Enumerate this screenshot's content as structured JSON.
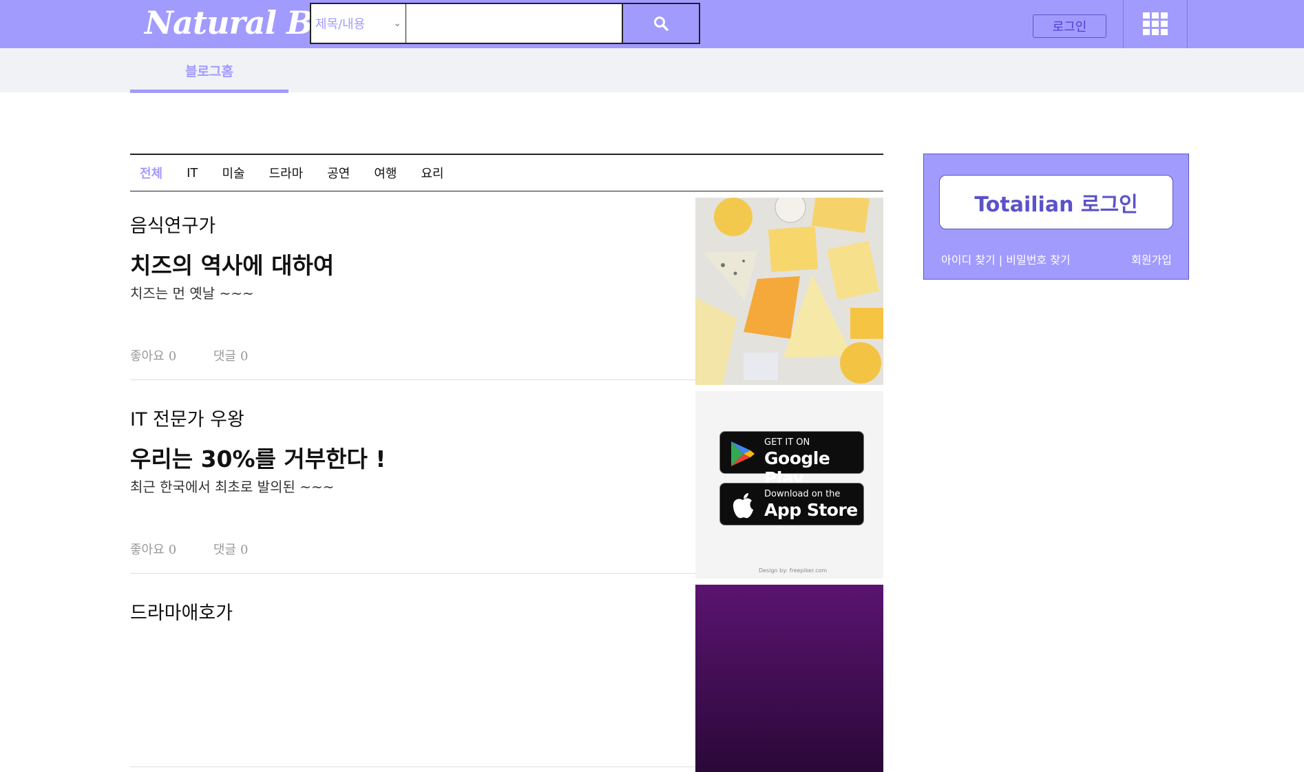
{
  "header": {
    "logo": "Natural Blog",
    "search_select": "제목/내용",
    "search_value": "",
    "login_label": "로그인"
  },
  "subnav": {
    "tab_label": "블로그홈"
  },
  "categories": [
    "전체",
    "IT",
    "미술",
    "드라마",
    "공연",
    "여행",
    "요리"
  ],
  "posts": [
    {
      "author": "음식연구가",
      "title": "치즈의 역사에 대하여",
      "excerpt": "치즈는 먼 옛날 ~~~",
      "likes_label": "좋아요",
      "likes": "0",
      "comments_label": "댓글",
      "comments": "0"
    },
    {
      "author": "IT 전문가 우왕",
      "title": "우리는 30%를 거부한다 !",
      "excerpt": "최근 한국에서 최초로 발의된 ~~~",
      "likes_label": "좋아요",
      "likes": "0",
      "comments_label": "댓글",
      "comments": "0",
      "badges": {
        "google_small": "GET IT ON",
        "google_big": "Google Play",
        "apple_small": "Download on the",
        "apple_big": "App Store",
        "credit": "Design by: freepiker.com"
      }
    },
    {
      "author": "드라마애호가"
    }
  ],
  "sidebar": {
    "login_button": "Totailian 로그인",
    "find_links": "아이디 찾기 | 비밀번호 찾기",
    "join": "회원가입"
  },
  "colors": {
    "accent": "#a29bfe",
    "accent_dark": "#5b52c9"
  }
}
